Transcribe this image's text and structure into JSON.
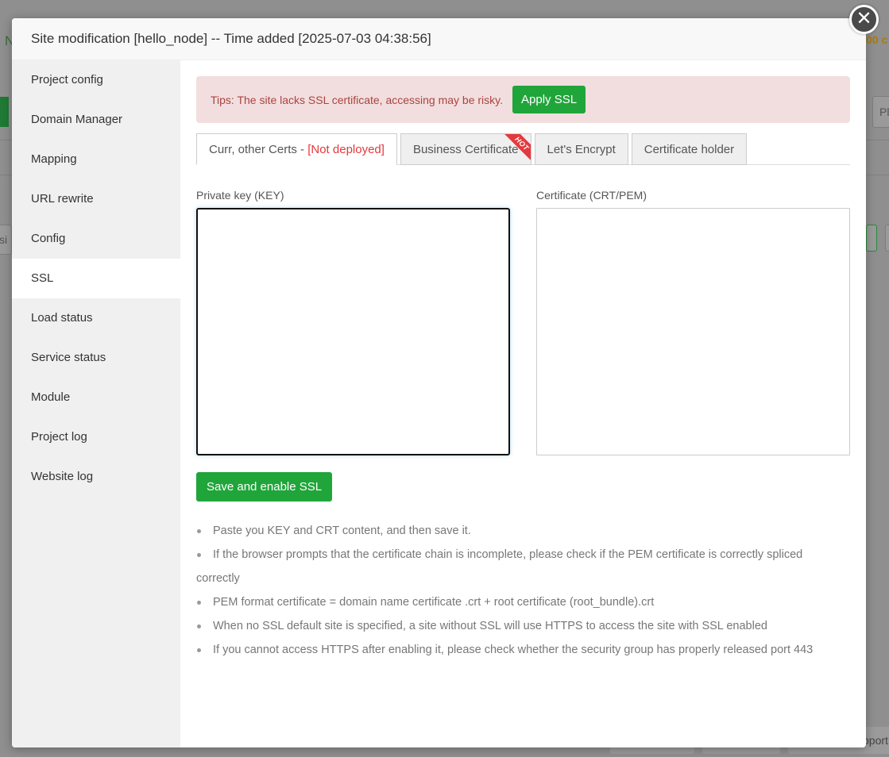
{
  "dialog": {
    "title": "Site modification [hello_node] -- Time added [2025-07-03 04:38:56]"
  },
  "background": {
    "left_fragment": "N",
    "right_fragment": "00 c",
    "input_fragment": "Pl",
    "left_input_fragment": "si",
    "footer_fragment": "pport"
  },
  "sidebar": {
    "items": [
      {
        "label": "Project config"
      },
      {
        "label": "Domain Manager"
      },
      {
        "label": "Mapping"
      },
      {
        "label": "URL rewrite"
      },
      {
        "label": "Config"
      },
      {
        "label": "SSL"
      },
      {
        "label": "Load status"
      },
      {
        "label": "Service status"
      },
      {
        "label": "Module"
      },
      {
        "label": "Project log"
      },
      {
        "label": "Website log"
      }
    ],
    "active": "SSL"
  },
  "tips": {
    "text": "Tips: The site lacks SSL certificate, accessing may be risky.",
    "button": "Apply SSL"
  },
  "tabs": [
    {
      "label": "Curr, other Certs - ",
      "status": "[Not deployed]"
    },
    {
      "label": "Business Certificate",
      "badge": "HOT"
    },
    {
      "label": "Let's Encrypt"
    },
    {
      "label": "Certificate holder"
    }
  ],
  "form": {
    "key_label": "Private key (KEY)",
    "key_value": "",
    "cert_label": "Certificate (CRT/PEM)",
    "cert_value": "",
    "save_button": "Save and enable SSL"
  },
  "notes": [
    "Paste you KEY and CRT content, and then save it.",
    "If the browser prompts that the certificate chain is incomplete, please check if the PEM certificate is correctly spliced",
    "correctly",
    "PEM format certificate = domain name certificate .crt + root certificate (root_bundle).crt",
    "When no SSL default site is specified, a site without SSL will use HTTPS to access the site with SSL enabled",
    "If you cannot access HTTPS after enabling it, please check whether the security group has properly released port 443"
  ],
  "colors": {
    "accent_green": "#20a53a",
    "tip_background": "#f2dede",
    "tip_text": "#a94442",
    "status_red": "#e4393c"
  }
}
